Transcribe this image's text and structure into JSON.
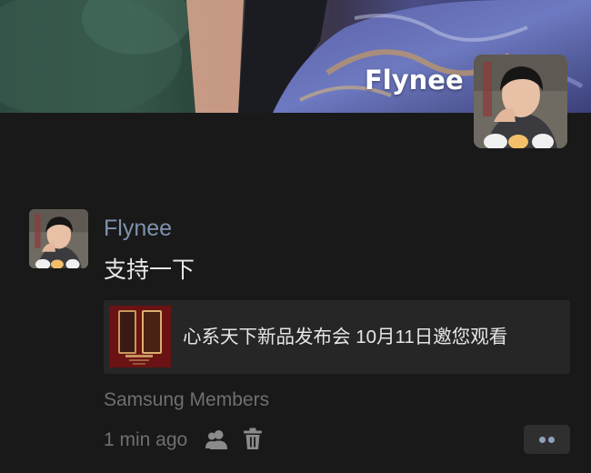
{
  "profile": {
    "cover_name": "Flynee"
  },
  "post": {
    "author": "Flynee",
    "text": "支持一下",
    "link_card": {
      "title": "心系天下新品发布会 10月11日邀您观看"
    },
    "source": "Samsung Members",
    "time": "1 min ago"
  },
  "icons": {
    "privacy": "people-icon",
    "delete": "trash-icon",
    "more": "more-dots-icon"
  },
  "colors": {
    "background": "#191919",
    "author_link": "#7e92ad",
    "secondary_text": "#6f6f6f",
    "card_background": "#262626",
    "more_dots": "#8ea0bd"
  }
}
